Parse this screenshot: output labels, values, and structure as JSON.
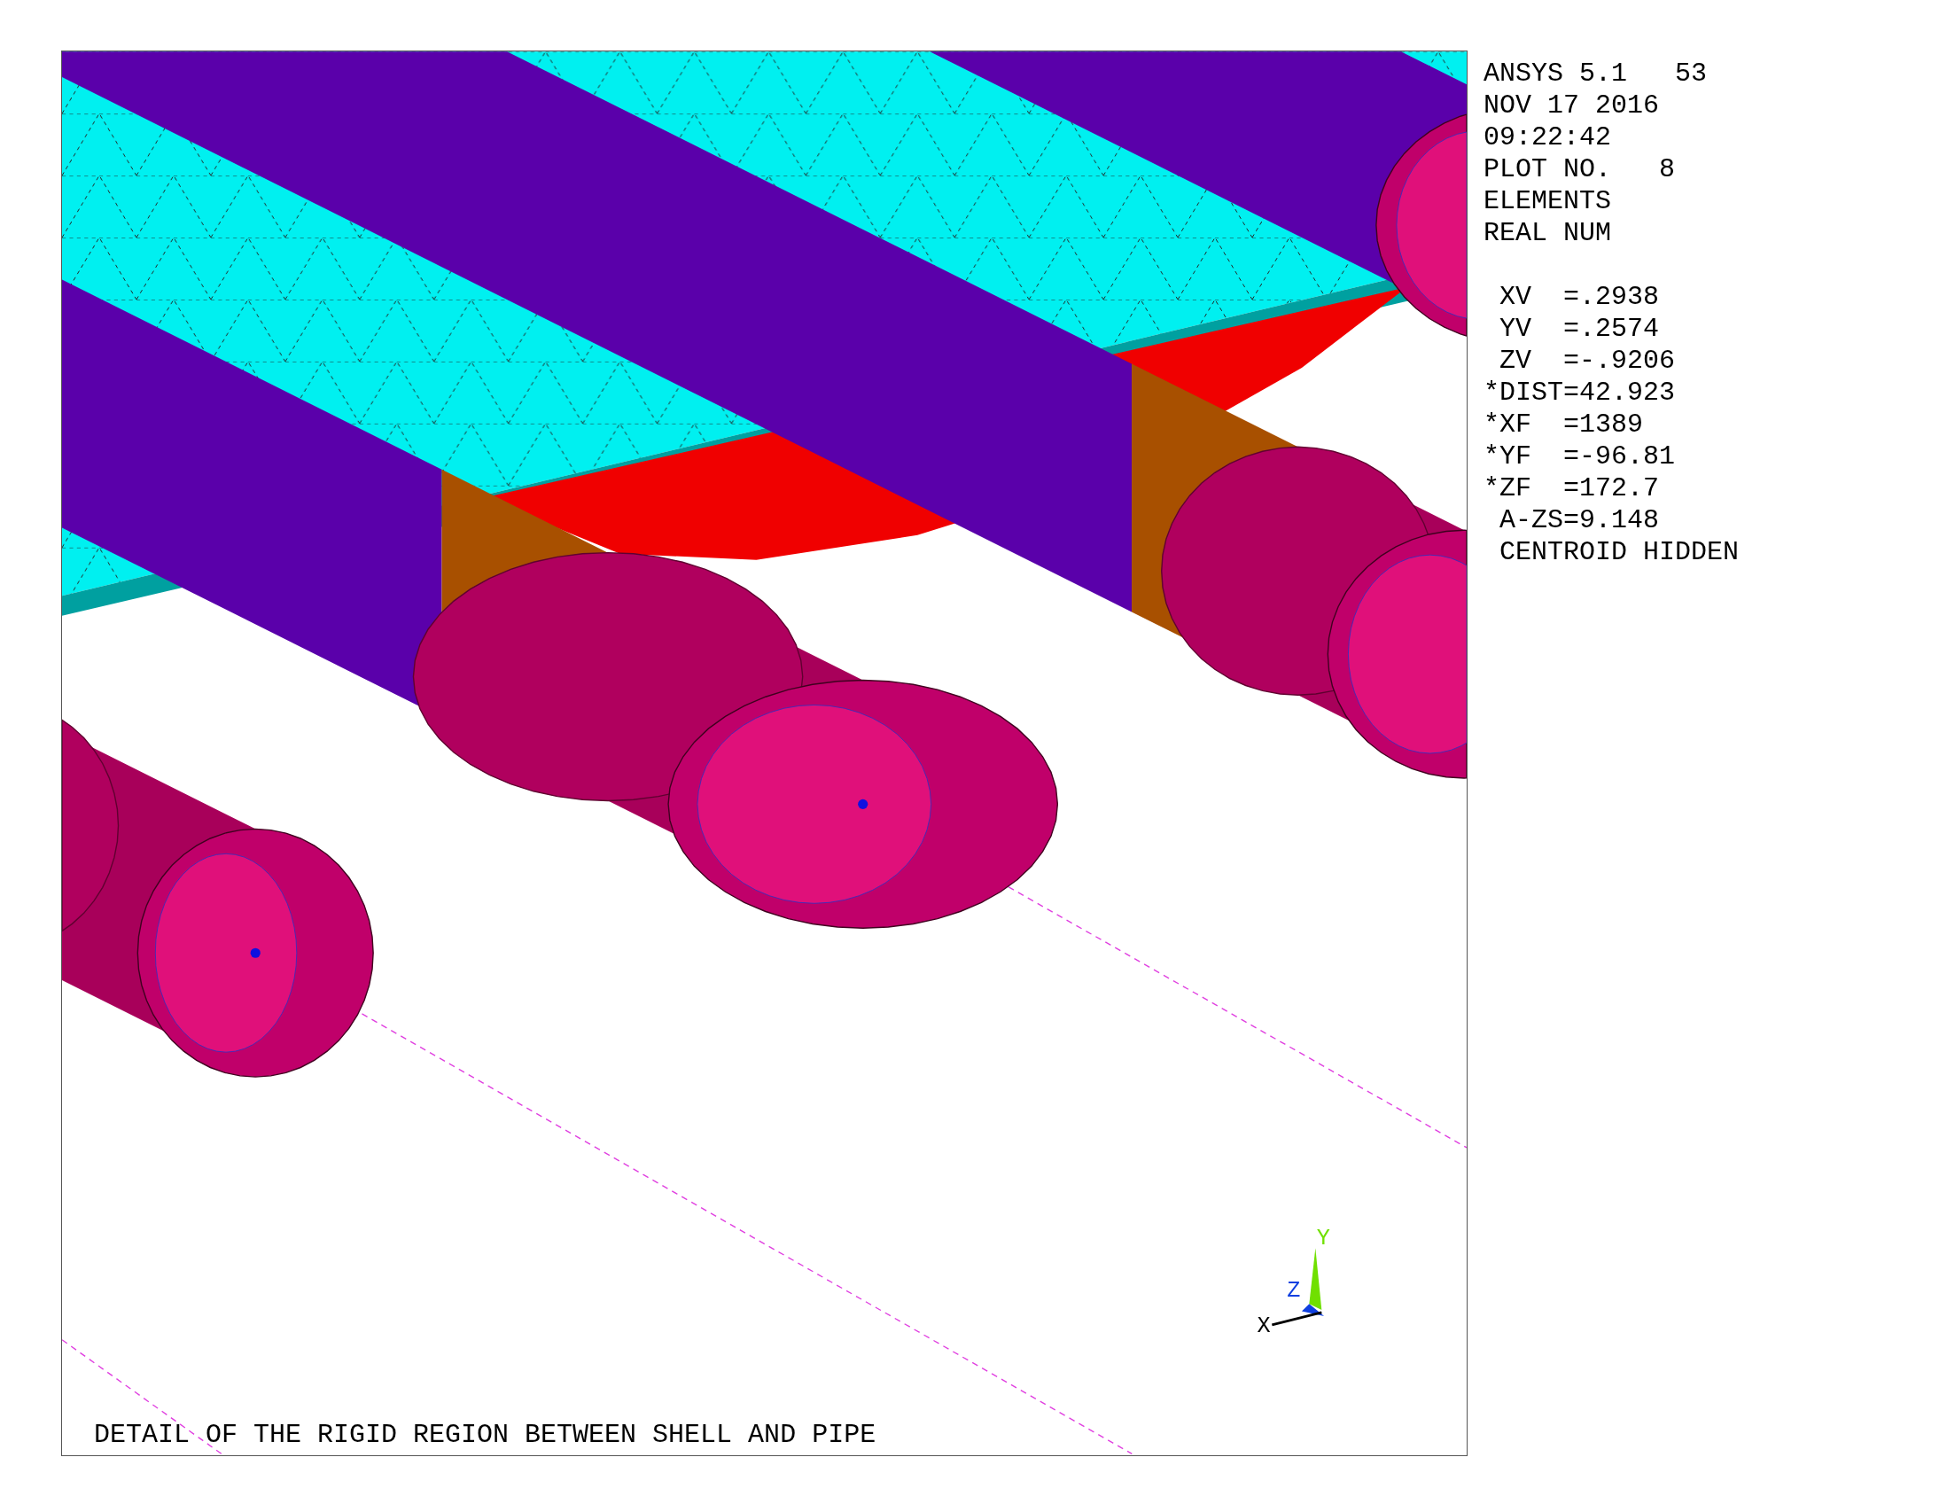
{
  "legend": {
    "info": [
      "ANSYS 5.1   53",
      "NOV 17 2016",
      "09:22:42",
      "PLOT NO.   8",
      "ELEMENTS",
      "REAL NUM"
    ],
    "view": [
      " XV  =.2938",
      " YV  =.2574",
      " ZV  =-.9206",
      "*DIST=42.923",
      "*XF  =1389",
      "*YF  =-96.81",
      "*ZF  =172.7",
      " A-ZS=9.148",
      " CENTROID HIDDEN"
    ]
  },
  "triad": {
    "x": "X",
    "y": "Y",
    "z": "Z"
  },
  "caption": "DETAIL OF THE RIGID REGION BETWEEN SHELL AND PIPE"
}
